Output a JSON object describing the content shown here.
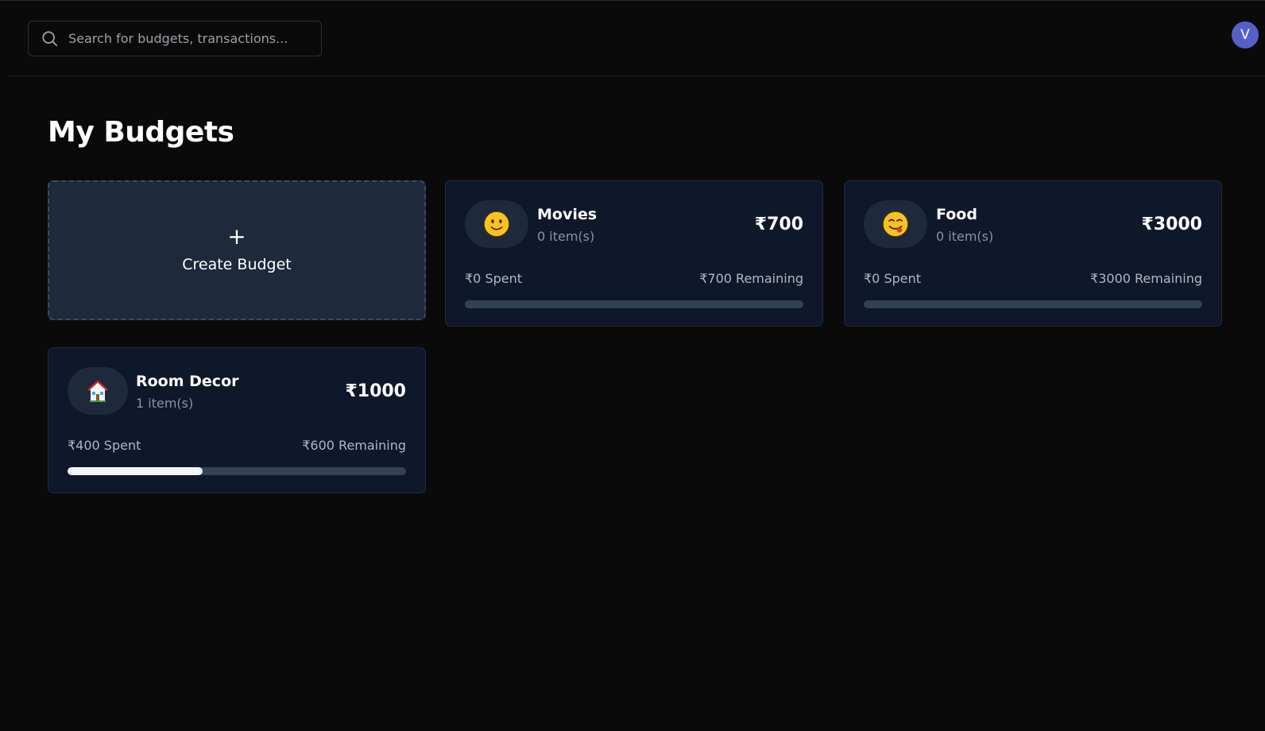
{
  "search": {
    "placeholder": "Search for budgets, transactions..."
  },
  "user": {
    "avatar_letter": "V"
  },
  "page": {
    "title": "My Budgets"
  },
  "create_card": {
    "plus": "+",
    "label": "Create Budget"
  },
  "budgets": [
    {
      "name": "Movies",
      "items": "0 item(s)",
      "amount": "₹700",
      "spent": "₹0 Spent",
      "remaining": "₹700 Remaining",
      "icon": "slightly-smiling-face-emoji",
      "progress": 0
    },
    {
      "name": "Food",
      "items": "0 item(s)",
      "amount": "₹3000",
      "spent": "₹0 Spent",
      "remaining": "₹3000 Remaining",
      "icon": "face-savoring-food-emoji",
      "progress": 0
    },
    {
      "name": "Room Decor",
      "items": "1 item(s)",
      "amount": "₹1000",
      "spent": "₹400 Spent",
      "remaining": "₹600 Remaining",
      "icon": "house-emoji",
      "progress": 0.4
    }
  ],
  "colors": {
    "background": "#0a0a0a",
    "card": "#0f172a",
    "create_card": "#1e293b",
    "progress_track": "#334155",
    "progress_fill": "#f1f5f9",
    "avatar": "#5561c9"
  }
}
